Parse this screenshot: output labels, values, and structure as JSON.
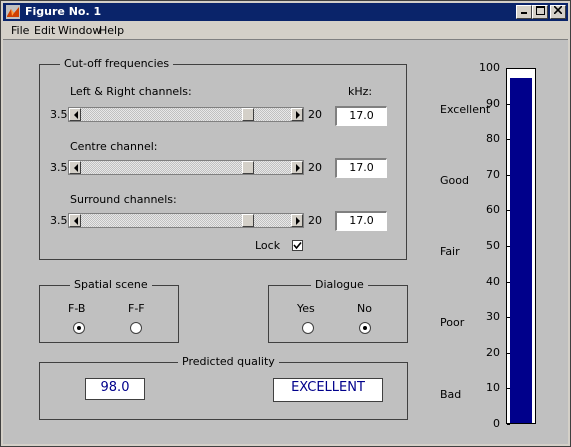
{
  "window": {
    "title": "Figure No. 1"
  },
  "menu": [
    "File",
    "Edit",
    "Window",
    "Help"
  ],
  "cutoff": {
    "title": "Cut-off frequencies",
    "unit_label": "kHz:",
    "lr_label": "Left & Right channels:",
    "centre_label": "Centre channel:",
    "surround_label": "Surround channels:",
    "min": "3.5",
    "max": "20",
    "lr_value": "17.0",
    "centre_value": "17.0",
    "surround_value": "17.0",
    "lock_label": "Lock",
    "lock_checked": true
  },
  "spatial": {
    "title": "Spatial scene",
    "opt1": "F-B",
    "opt2": "F-F",
    "selected": "F-B"
  },
  "dialogue": {
    "title": "Dialogue",
    "opt1": "Yes",
    "opt2": "No",
    "selected": "No"
  },
  "quality": {
    "title": "Predicted quality",
    "value": "98.0",
    "grade": "EXCELLENT"
  },
  "chart_data": {
    "type": "bar",
    "categories": [
      ""
    ],
    "values": [
      98
    ],
    "ylim": [
      0,
      100
    ],
    "yticks": [
      "0",
      "10",
      "20",
      "30",
      "40",
      "50",
      "60",
      "70",
      "80",
      "90",
      "100"
    ],
    "grade_labels": [
      "Excellent",
      "Good",
      "Fair",
      "Poor",
      "Bad"
    ],
    "bar_color": "#00008b"
  }
}
